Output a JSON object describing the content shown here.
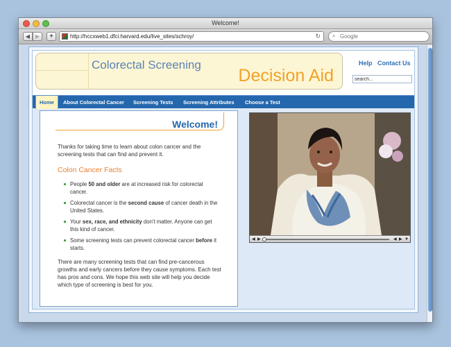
{
  "browser": {
    "window_title": "Welcome!",
    "url": "http://hccxweb1.dfci.harvard.edu/live_sites/schroy/",
    "search_placeholder": "Google"
  },
  "site": {
    "title_line1": "Colorectal Screening",
    "title_line2": "Decision Aid",
    "header_links": {
      "help": "Help",
      "contact": "Contact Us"
    },
    "search_value": "search...",
    "nav": [
      "Home",
      "About Colorectal Cancer",
      "Screening Tests",
      "Screening Attributes",
      "Choose a Test"
    ],
    "active_nav": "Home"
  },
  "content": {
    "heading": "Welcome!",
    "intro": "Thanks for taking time to learn about colon cancer and the screening tests that can find and prevent it.",
    "facts_heading": "Colon Cancer Facts",
    "facts": [
      {
        "pre": "People ",
        "bold": "50 and older",
        "post": " are at increased risk for colorectal cancer."
      },
      {
        "pre": "Colorectal cancer is the ",
        "bold": "second cause",
        "post": " of cancer death in the United States."
      },
      {
        "pre": "Your ",
        "bold": "sex, race, and ethnicity",
        "post": " don't matter. Anyone can get this kind of cancer."
      },
      {
        "pre": "Some screening tests can prevent colorectal cancer ",
        "bold": "before",
        "post": " it starts."
      }
    ],
    "outro": "There are many screening tests that can find pre-cancerous growths and early cancers before they cause symptoms. Each test has pros and cons. We hope this web site will help you decide which type of screening is best for you."
  },
  "video": {
    "progress": 0.0
  },
  "colors": {
    "nav_blue": "#2467ad",
    "title_blue": "#5a83b4",
    "title_orange": "#f0a22a",
    "facts_orange": "#ef7d2a",
    "bullet_green": "#49a54a"
  },
  "icons": [
    "back-arrow-icon",
    "forward-arrow-icon",
    "plus-icon",
    "favicon",
    "reload-icon",
    "search-icon",
    "play-icon",
    "volume-icon",
    "fullscreen-icon"
  ]
}
